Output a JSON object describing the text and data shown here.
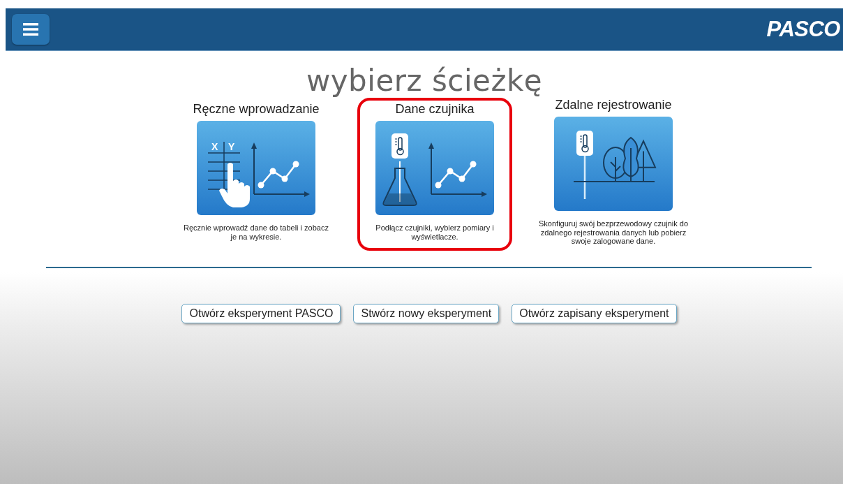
{
  "header": {
    "logo": "PASCO"
  },
  "title": "wybierz ścieżkę",
  "paths": [
    {
      "kind": "manual",
      "title": "Ręczne wprowadzanie",
      "axis_labels": [
        "X",
        "Y"
      ],
      "description": "Ręcznie wprowadź dane do tabeli i zobacz je na wykresie.",
      "selected": false
    },
    {
      "kind": "sensor",
      "title": "Dane czujnika",
      "description": "Podłącz czujniki, wybierz pomiary i wyświetlacze.",
      "selected": true
    },
    {
      "kind": "remote",
      "title": "Zdalne rejestrowanie",
      "description": "Skonfiguruj swój bezprzewodowy czujnik do zdalnego rejestrowania danych lub pobierz swoje zalogowane dane.",
      "selected": false
    }
  ],
  "buttons": [
    "Otwórz eksperyment PASCO",
    "Stwórz nowy eksperyment",
    "Otwórz zapisany eksperyment"
  ]
}
